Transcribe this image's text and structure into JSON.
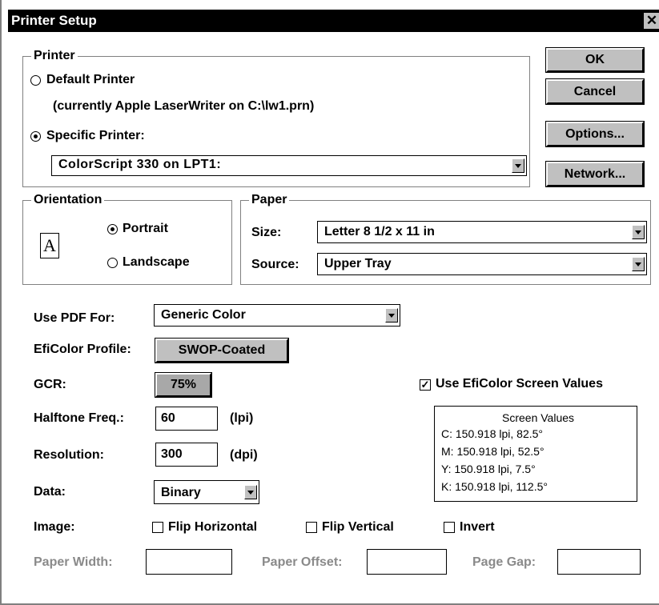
{
  "window": {
    "title": "Printer Setup",
    "close_glyph": "✕"
  },
  "printer_group": {
    "title": "Printer",
    "default_label": "Default Printer",
    "default_note": "(currently Apple LaserWriter on C:\\lw1.prn)",
    "specific_label": "Specific Printer:",
    "selected_radio": "specific",
    "printer_value": "ColorScript 330 on LPT1:"
  },
  "buttons": {
    "ok": "OK",
    "cancel": "Cancel",
    "options": "Options...",
    "network": "Network..."
  },
  "orientation": {
    "title": "Orientation",
    "portrait": "Portrait",
    "landscape": "Landscape",
    "selected": "portrait",
    "icon_glyph": "A"
  },
  "paper": {
    "title": "Paper",
    "size_label": "Size:",
    "size_value": "Letter 8 1/2 x 11 in",
    "source_label": "Source:",
    "source_value": "Upper Tray"
  },
  "pdf": {
    "label": "Use PDF For:",
    "value": "Generic Color"
  },
  "efi_profile": {
    "label": "EfiColor Profile:",
    "value": "SWOP-Coated"
  },
  "gcr": {
    "label": "GCR:",
    "value": "75%"
  },
  "use_screen_values": {
    "label": "Use EfiColor Screen Values",
    "checked": true
  },
  "halftone": {
    "label": "Halftone Freq.:",
    "value": "60",
    "unit": "(lpi)"
  },
  "resolution": {
    "label": "Resolution:",
    "value": "300",
    "unit": "(dpi)"
  },
  "data_field": {
    "label": "Data:",
    "value": "Binary"
  },
  "screen_values": {
    "title": "Screen Values",
    "lines": [
      "C: 150.918 lpi, 82.5°",
      "M: 150.918 lpi, 52.5°",
      "Y: 150.918 lpi, 7.5°",
      "K: 150.918 lpi, 112.5°"
    ]
  },
  "image": {
    "label": "Image:",
    "flip_h": "Flip Horizontal",
    "flip_v": "Flip Vertical",
    "invert": "Invert"
  },
  "paper_dims": {
    "width_label": "Paper Width:",
    "offset_label": "Paper Offset:",
    "gap_label": "Page Gap:"
  }
}
